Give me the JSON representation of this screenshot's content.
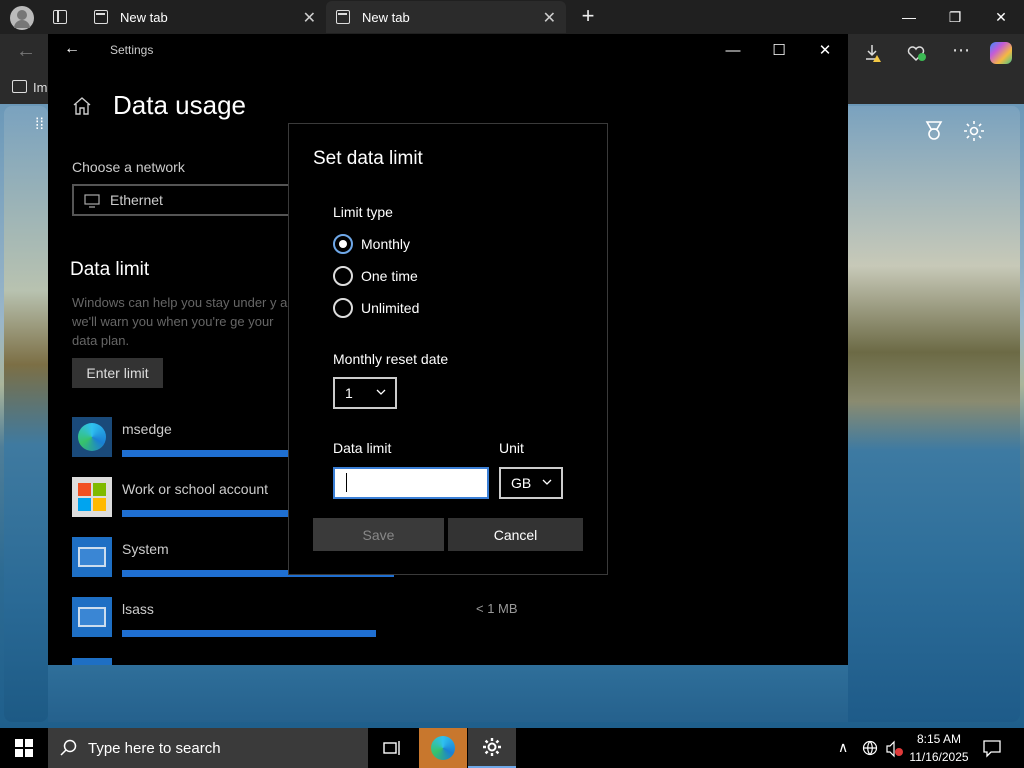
{
  "browser": {
    "tabs": [
      {
        "label": "New tab"
      },
      {
        "label": "New tab"
      }
    ],
    "favorites_label": "Im"
  },
  "settings_window": {
    "title": "Settings",
    "page_title": "Data usage",
    "network_label": "Choose a network",
    "network_value": "Ethernet",
    "data_limit_title": "Data limit",
    "data_limit_desc": "Windows can help you stay under y and we'll warn you when you're ge your data plan.",
    "enter_limit_label": "Enter limit",
    "apps": [
      {
        "name": "msedge",
        "size": "",
        "icon": "edge-icon",
        "usage": 0.55
      },
      {
        "name": "Work or school account",
        "size": "",
        "icon": "windows-logo-icon",
        "usage": 0.5
      },
      {
        "name": "System",
        "size": "",
        "icon": "system-app-icon",
        "usage": 0.45
      },
      {
        "name": "lsass",
        "size": "< 1 MB",
        "icon": "system-app-icon",
        "usage": 0.4
      }
    ]
  },
  "dialog": {
    "title": "Set data limit",
    "limit_type_label": "Limit type",
    "options": [
      "Monthly",
      "One time",
      "Unlimited"
    ],
    "selected_option": "Monthly",
    "reset_date_label": "Monthly reset date",
    "reset_date_value": "1",
    "data_limit_label": "Data limit",
    "data_limit_value": "",
    "unit_label": "Unit",
    "unit_value": "GB",
    "save_label": "Save",
    "cancel_label": "Cancel"
  },
  "taskbar": {
    "search_placeholder": "Type here to search",
    "time": "8:15 AM",
    "date": "11/16/2025"
  },
  "colors": {
    "accent": "#1f6fd1",
    "input_focus": "#3b7fd6",
    "active_app_highlight": "#c8772d"
  }
}
